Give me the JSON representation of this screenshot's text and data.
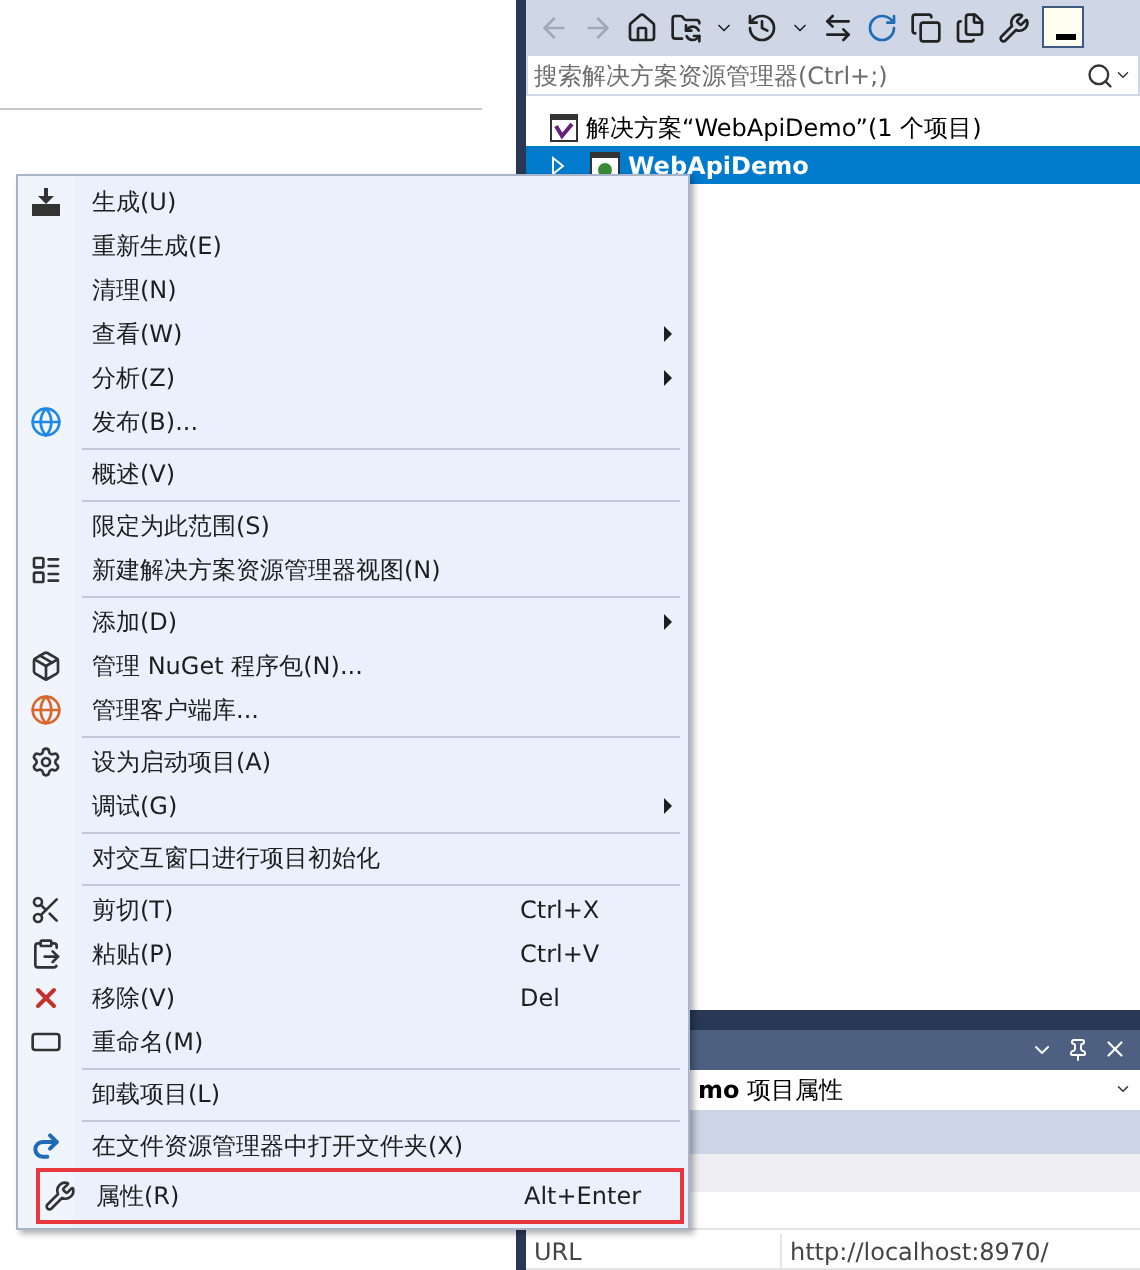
{
  "solution_explorer": {
    "search": {
      "placeholder": "搜索解决方案资源管理器(Ctrl+;)"
    },
    "tree": [
      {
        "label": "解决方案“WebApiDemo”(1 个项目)",
        "selected": false,
        "children": [
          {
            "label": "WebApiDemo",
            "selected": true,
            "expanded": false
          }
        ]
      }
    ]
  },
  "properties_panel": {
    "title": "**mo** 项目属性",
    "rows": [
      {
        "name": "URL",
        "value": "http://localhost:8970/"
      }
    ]
  },
  "context_menu": [
    {
      "kind": "item",
      "label": "生成(U)",
      "submenu": false,
      "highlighted": false
    },
    {
      "kind": "item",
      "label": "重新生成(E)",
      "submenu": false,
      "highlighted": false
    },
    {
      "kind": "item",
      "label": "清理(N)",
      "submenu": false,
      "highlighted": false
    },
    {
      "kind": "item",
      "label": "查看(W)",
      "submenu": true,
      "highlighted": false
    },
    {
      "kind": "item",
      "label": "分析(Z)",
      "submenu": true,
      "highlighted": false
    },
    {
      "kind": "item",
      "label": "发布(B)...",
      "submenu": false,
      "highlighted": false
    },
    {
      "kind": "separator"
    },
    {
      "kind": "item",
      "label": "概述(V)",
      "submenu": false,
      "highlighted": false
    },
    {
      "kind": "separator"
    },
    {
      "kind": "item",
      "label": "限定为此范围(S)",
      "submenu": false,
      "highlighted": false
    },
    {
      "kind": "item",
      "label": "新建解决方案资源管理器视图(N)",
      "submenu": false,
      "highlighted": false
    },
    {
      "kind": "separator"
    },
    {
      "kind": "item",
      "label": "添加(D)",
      "submenu": true,
      "highlighted": false
    },
    {
      "kind": "item",
      "label": "管理 NuGet 程序包(N)...",
      "submenu": false,
      "highlighted": false
    },
    {
      "kind": "item",
      "label": "管理客户端库...",
      "submenu": false,
      "highlighted": false
    },
    {
      "kind": "separator"
    },
    {
      "kind": "item",
      "label": "设为启动项目(A)",
      "submenu": false,
      "highlighted": false
    },
    {
      "kind": "item",
      "label": "调试(G)",
      "submenu": true,
      "highlighted": false
    },
    {
      "kind": "separator"
    },
    {
      "kind": "item",
      "label": "对交互窗口进行项目初始化",
      "submenu": false,
      "highlighted": false
    },
    {
      "kind": "separator"
    },
    {
      "kind": "item",
      "label": "剪切(T)",
      "shortcut": "Ctrl+X",
      "submenu": false,
      "highlighted": false
    },
    {
      "kind": "item",
      "label": "粘贴(P)",
      "shortcut": "Ctrl+V",
      "submenu": false,
      "highlighted": false
    },
    {
      "kind": "item",
      "label": "移除(V)",
      "shortcut": "Del",
      "submenu": false,
      "highlighted": false
    },
    {
      "kind": "item",
      "label": "重命名(M)",
      "submenu": false,
      "highlighted": false
    },
    {
      "kind": "separator"
    },
    {
      "kind": "item",
      "label": "卸载项目(L)",
      "submenu": false,
      "highlighted": false
    },
    {
      "kind": "separator"
    },
    {
      "kind": "item",
      "label": "在文件资源管理器中打开文件夹(X)",
      "submenu": false,
      "highlighted": false
    },
    {
      "kind": "item",
      "label": "属性(R)",
      "shortcut": "Alt+Enter",
      "submenu": false,
      "highlighted": true
    }
  ]
}
